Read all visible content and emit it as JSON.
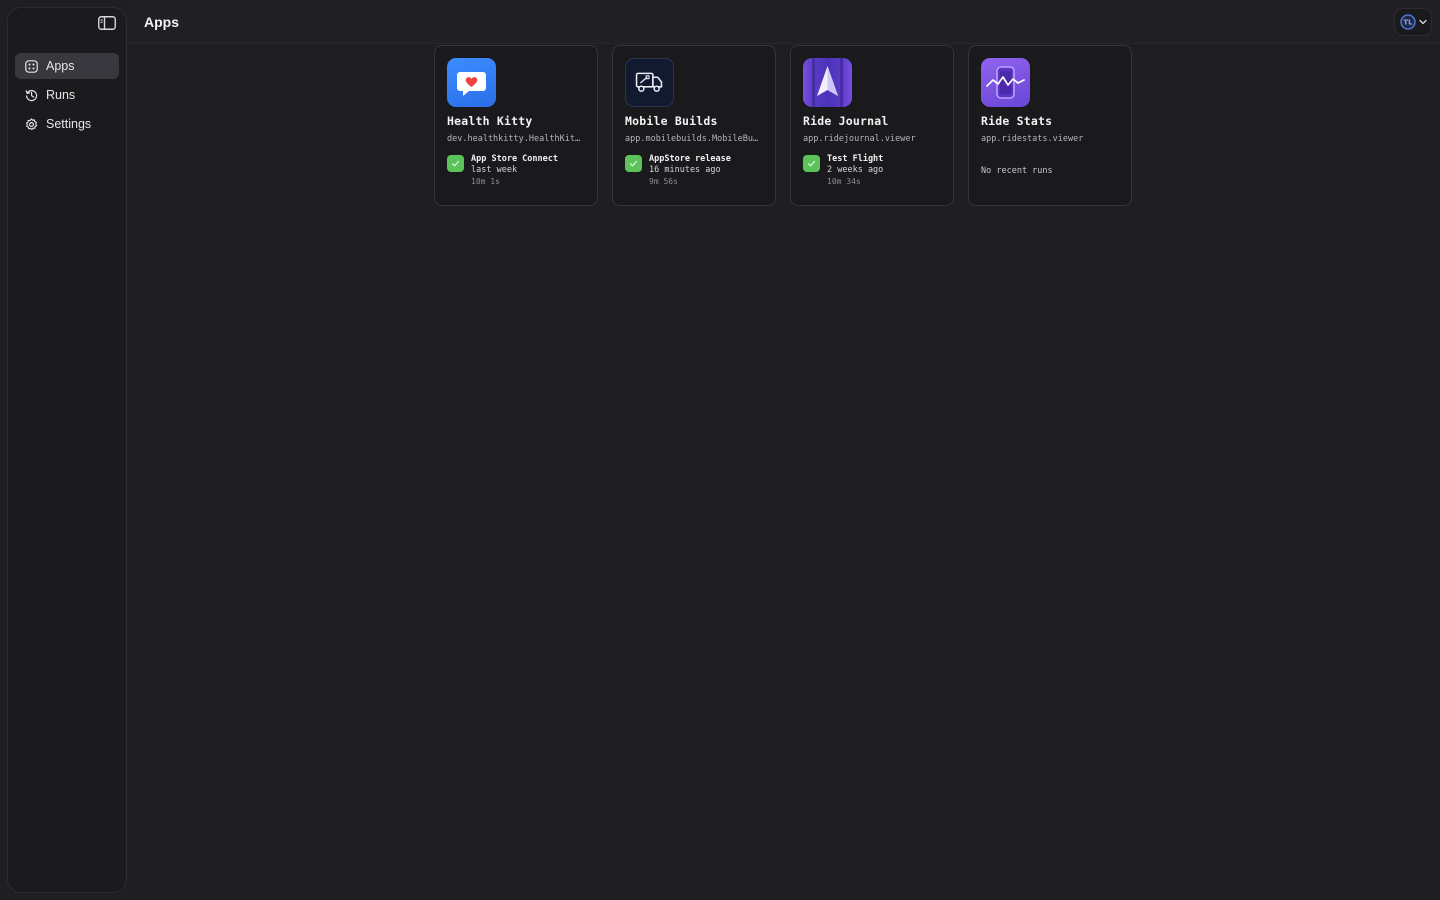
{
  "header": {
    "title": "Apps"
  },
  "sidebar": {
    "items": [
      {
        "label": "Apps",
        "icon": "apps-icon",
        "active": true
      },
      {
        "label": "Runs",
        "icon": "history-icon",
        "active": false
      },
      {
        "label": "Settings",
        "icon": "gear-icon",
        "active": false
      }
    ]
  },
  "apps": [
    {
      "name": "Health Kitty",
      "bundle_id": "dev.healthkitty.HealthKitty",
      "icon": "heart-chat-icon",
      "run": {
        "name": "App Store Connect",
        "time": "last week",
        "duration": "10m 1s",
        "status": "success"
      }
    },
    {
      "name": "Mobile Builds",
      "bundle_id": "app.mobilebuilds.MobileBuilds",
      "icon": "delivery-truck-icon",
      "run": {
        "name": "AppStore release",
        "time": "16 minutes ago",
        "duration": "9m 56s",
        "status": "success"
      }
    },
    {
      "name": "Ride Journal",
      "bundle_id": "app.ridejournal.viewer",
      "icon": "navigation-arrow-icon",
      "run": {
        "name": "Test Flight",
        "time": "2 weeks ago",
        "duration": "10m 34s",
        "status": "success"
      }
    },
    {
      "name": "Ride Stats",
      "bundle_id": "app.ridestats.viewer",
      "icon": "phone-chart-icon",
      "no_runs_label": "No recent runs"
    }
  ],
  "colors": {
    "background": "#1f1f23",
    "sidebar": "#1b1b1e",
    "card": "#1a1a1d",
    "success": "#5cc35a",
    "active_nav": "#38383e"
  }
}
